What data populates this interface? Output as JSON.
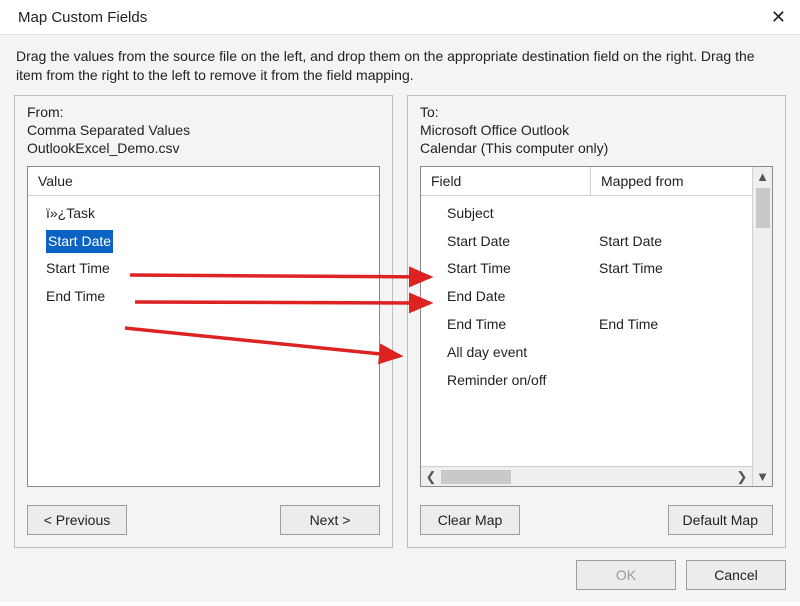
{
  "title": "Map Custom Fields",
  "instructions": "Drag the values from the source file on the left, and drop them on the appropriate destination field on the right.  Drag the item from the right to the left to remove it from the field mapping.",
  "from": {
    "label": "From:",
    "source_type": "Comma Separated Values",
    "filename": "OutlookExcel_Demo.csv",
    "header_value": "Value",
    "items": [
      {
        "label": "ï»¿Task",
        "selected": false
      },
      {
        "label": "Start Date",
        "selected": true
      },
      {
        "label": "Start Time",
        "selected": false
      },
      {
        "label": "End Time",
        "selected": false
      }
    ]
  },
  "to": {
    "label": "To:",
    "target_app": "Microsoft Office Outlook",
    "folder": "Calendar (This computer only)",
    "header_field": "Field",
    "header_mapped": "Mapped from",
    "items": [
      {
        "field": "Subject",
        "mapped": ""
      },
      {
        "field": "Start Date",
        "mapped": "Start Date"
      },
      {
        "field": "Start Time",
        "mapped": "Start Time"
      },
      {
        "field": "End Date",
        "mapped": ""
      },
      {
        "field": "End Time",
        "mapped": "End Time"
      },
      {
        "field": "All day event",
        "mapped": ""
      },
      {
        "field": "Reminder on/off",
        "mapped": ""
      }
    ]
  },
  "buttons": {
    "previous": "< Previous",
    "next": "Next >",
    "clear_map": "Clear Map",
    "default_map": "Default Map",
    "ok": "OK",
    "cancel": "Cancel"
  }
}
